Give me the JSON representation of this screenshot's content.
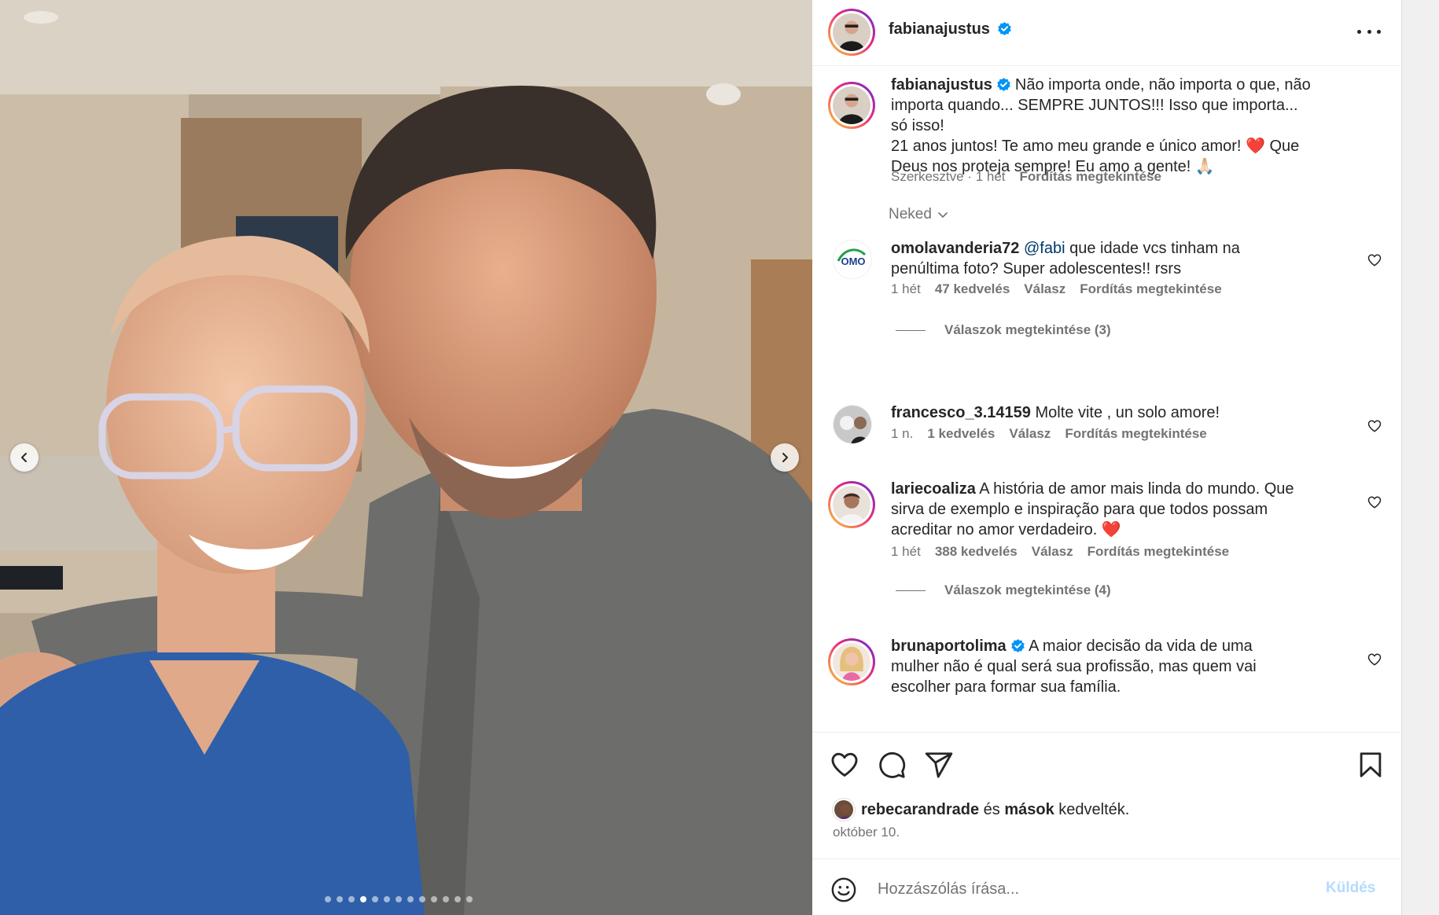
{
  "post": {
    "username": "fabianajustus",
    "carousel": {
      "count": 13,
      "active_index": 3
    }
  },
  "caption": {
    "username": "fabianajustus",
    "line1": "Não importa onde, não importa o que, não",
    "line2": "importa quando... SEMPRE JUNTOS!!! Isso que importa...",
    "line3": "só isso!",
    "line4": "21 anos juntos! Te amo meu grande e único amor! ❤️ Que",
    "line5": "Deus nos proteja sempre! Eu amo a gente! 🙏🏻",
    "edited": "Szerkesztve · 1 hét",
    "translate": "Fordítás megtekintése"
  },
  "filter": {
    "label": "Neked"
  },
  "comments": [
    {
      "username": "omolavanderia72",
      "mention": "@fabi",
      "text_line1": " que idade vcs tinham na",
      "text_line2": "penúltima foto? Super adolescentes!! rsrs",
      "time": "1 hét",
      "likes": "47 kedvelés",
      "reply": "Válasz",
      "translate": "Fordítás megtekintése",
      "view_replies": "Válaszok megtekintése (3)",
      "avatar_text": "OMO"
    },
    {
      "username": "francesco_3.14159",
      "text_line1": " Molte vite , un solo amore!",
      "time": "1 n.",
      "likes": "1 kedvelés",
      "reply": "Válasz",
      "translate": "Fordítás megtekintése"
    },
    {
      "username": "lariecoaliza",
      "text_line1": " A história de amor mais linda do mundo. Que",
      "text_line2": "sirva de exemplo e inspiração para que todos possam",
      "text_line3": "acreditar no amor verdadeiro. ❤️",
      "time": "1 hét",
      "likes": "388 kedvelés",
      "reply": "Válasz",
      "translate": "Fordítás megtekintése",
      "view_replies": "Válaszok megtekintése (4)"
    },
    {
      "username": "brunaportolima",
      "text_line1": " A maior decisão da vida de uma",
      "text_line2": "mulher não é qual será sua profissão, mas quem vai",
      "text_line3": "escolher para formar sua família."
    }
  ],
  "likes_summary": {
    "user": "rebecarandrade",
    "connector": " és ",
    "others": "mások",
    "suffix": " kedvelték."
  },
  "date": "október 10.",
  "composer": {
    "placeholder": "Hozzászólás írása...",
    "send": "Küldés"
  },
  "colors": {
    "link": "#00376b",
    "muted": "#737373",
    "verified": "#0095f6",
    "heart": "#e0182d",
    "send_disabled": "#b3dbff"
  }
}
